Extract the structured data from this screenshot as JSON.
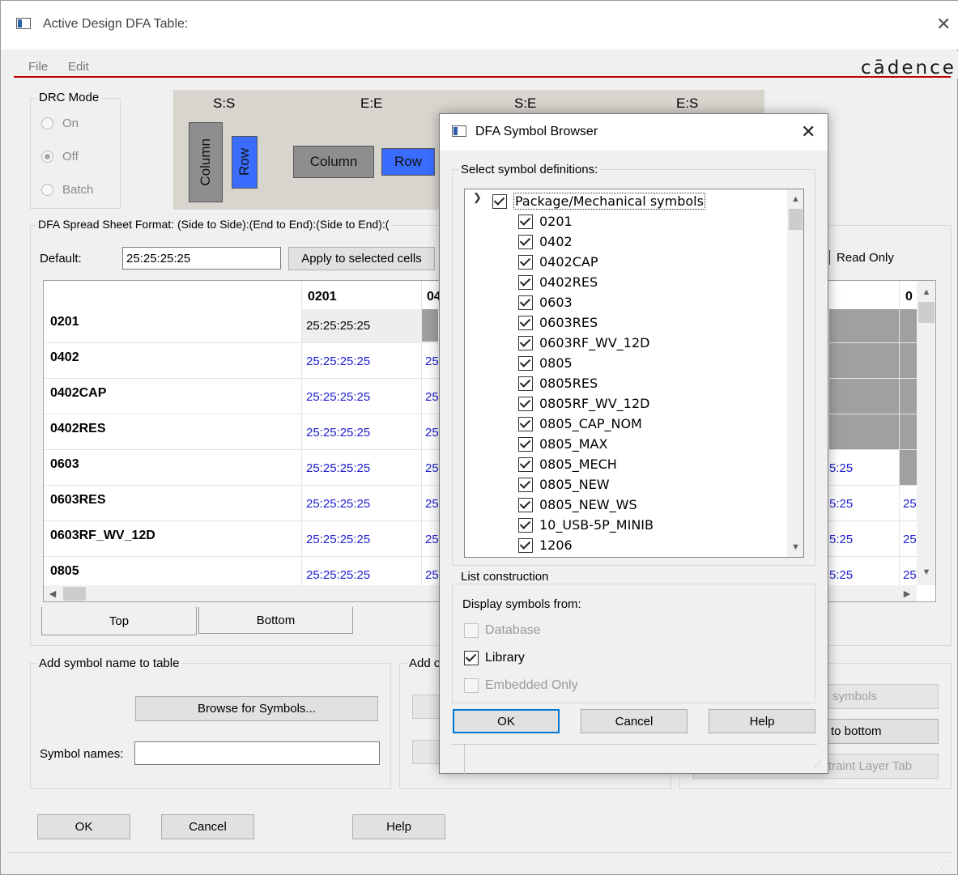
{
  "window": {
    "title": "Active Design DFA Table:",
    "close_glyph": "✕"
  },
  "menu": {
    "items": [
      "File",
      "Edit"
    ],
    "brand": "cādence"
  },
  "drc_mode": {
    "label": "DRC Mode",
    "options": [
      "On",
      "Off",
      "Batch"
    ],
    "selected": "Off"
  },
  "legend": {
    "headers": [
      "S:S",
      "E:E",
      "S:E",
      "E:S"
    ],
    "column_label": "Column",
    "row_label": "Row",
    "colors": {
      "column": "#8e8e8e",
      "row": "#3a6cff"
    }
  },
  "spreadsheet": {
    "format_label": "DFA Spread Sheet Format: (Side to Side):(End to End):(Side to End):(",
    "default_label": "Default:",
    "default_value": "25:25:25:25",
    "apply_label": "Apply to selected cells",
    "read_only_label": "Read Only",
    "col_headers": [
      "0201",
      "04",
      "0"
    ],
    "rows": [
      "0201",
      "0402",
      "0402CAP",
      "0402RES",
      "0603",
      "0603RES",
      "0603RF_WV_12D",
      "0805"
    ],
    "cell_value": "25:25:25:25",
    "cell_partial": "25",
    "right_partial": "5:25",
    "far_partial": "25",
    "tabs": [
      "Top",
      "Bottom"
    ]
  },
  "add_symbol": {
    "label": "Add symbol name to table",
    "browse_label": "Browse for Symbols...",
    "names_label": "Symbol names:",
    "names_value": ""
  },
  "add_other": {
    "label": "Add c"
  },
  "right_buttons": [
    "symbols",
    "to bottom",
    "traint Layer Tab"
  ],
  "footer": {
    "ok": "OK",
    "cancel": "Cancel",
    "help": "Help"
  },
  "symbol_browser": {
    "title": "DFA Symbol Browser",
    "close_glyph": "✕",
    "select_label": "Select symbol definitions:",
    "root": "Package/Mechanical symbols",
    "items": [
      "0201",
      "0402",
      "0402CAP",
      "0402RES",
      "0603",
      "0603RES",
      "0603RF_WV_12D",
      "0805",
      "0805RES",
      "0805RF_WV_12D",
      "0805_CAP_NOM",
      "0805_MAX",
      "0805_MECH",
      "0805_NEW",
      "0805_NEW_WS",
      "10_USB-5P_MINIB",
      "1206"
    ],
    "list_construction": {
      "label": "List construction",
      "display_from": "Display symbols from:",
      "database": "Database",
      "library": "Library",
      "embedded": "Embedded Only"
    },
    "ok": "OK",
    "cancel": "Cancel",
    "help": "Help"
  }
}
